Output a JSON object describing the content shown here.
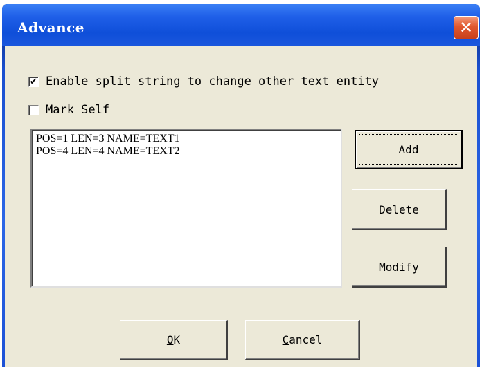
{
  "window": {
    "title": "Advance",
    "close_glyph": "✕"
  },
  "options": {
    "split_string": {
      "label": "Enable split string to change other text entity",
      "checked": true,
      "check_glyph": "✔"
    },
    "mark_self": {
      "label": "Mark Self",
      "checked": false
    }
  },
  "list": {
    "items": [
      "POS=1 LEN=3 NAME=TEXT1",
      "POS=4 LEN=4 NAME=TEXT2"
    ]
  },
  "buttons": {
    "add": "Add",
    "delete": "Delete",
    "modify": "Modify",
    "ok_mnemonic": "O",
    "ok_rest": "K",
    "cancel_mnemonic": "C",
    "cancel_rest": "ancel"
  },
  "colors": {
    "titlebar": "#1f5fe8",
    "close_button": "#e1582e",
    "dialog_bg": "#ece9d8"
  }
}
